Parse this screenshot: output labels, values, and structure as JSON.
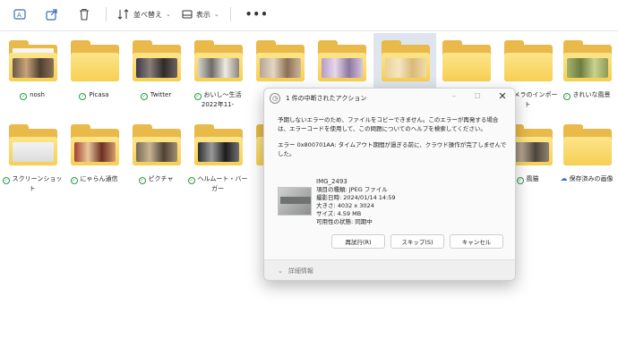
{
  "toolbar": {
    "sort_label": "並べ替え",
    "view_label": "表示",
    "more_label": "•••"
  },
  "folders_row1": [
    {
      "label": "nosh",
      "synced": true
    },
    {
      "label": "Picasa",
      "synced": true
    },
    {
      "label": "Twitter",
      "synced": true
    },
    {
      "label": "おいし～生活 2022年11-",
      "synced": true
    },
    {
      "label": "",
      "synced": false
    },
    {
      "label": "",
      "synced": false
    },
    {
      "label": "",
      "synced": false
    },
    {
      "label": "",
      "synced": false
    },
    {
      "label": "カメラのインポート",
      "synced": true
    },
    {
      "label": "きれいな風景",
      "synced": true
    }
  ],
  "folders_row2": [
    {
      "label": "スクリーンショット",
      "synced": true
    },
    {
      "label": "にゃらん通信",
      "synced": true
    },
    {
      "label": "ピクチャ",
      "synced": true
    },
    {
      "label": "ヘルムート・バーガー",
      "synced": true
    },
    {
      "label": "",
      "synced": false
    },
    {
      "label": "",
      "synced": false
    },
    {
      "label": "",
      "synced": false
    },
    {
      "label": "",
      "synced": false
    },
    {
      "label": "風猫",
      "synced": true
    },
    {
      "label": "保存済みの画像",
      "cloud": true
    }
  ],
  "dialog": {
    "title": "1 件の中断されたアクション",
    "message": "予期しないエラーのため、ファイルをコピーできません。このエラーが再発する場合は、エラーコードを使用して、この問題についてのヘルプを検索してください。",
    "error": "エラー 0x800701AA: タイムアウト期間が過ぎる前に、クラウド操作が完了しませんでした。",
    "file": {
      "name": "IMG_2493",
      "type": "項目の種類: JPEG ファイル",
      "date": "撮影日時: 2024/01/14 14:59",
      "dimensions": "大きさ: 4032 x 3024",
      "size": "サイズ: 4.59 MB",
      "status": "可用性の状態: 同期中"
    },
    "retry_label": "再試行(R)",
    "skip_label": "スキップ(S)",
    "cancel_label": "キャンセル",
    "details_label": "詳細情報"
  }
}
